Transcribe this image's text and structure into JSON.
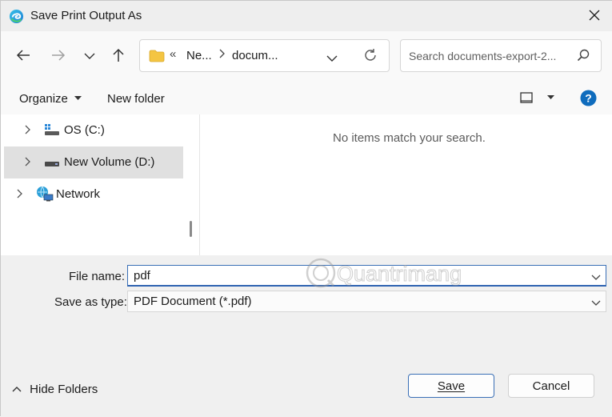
{
  "window": {
    "title": "Save Print Output As"
  },
  "address": {
    "overflow": "«",
    "crumbs": [
      "Ne...",
      "docum..."
    ]
  },
  "search": {
    "placeholder": "Search documents-export-2..."
  },
  "toolbar": {
    "organize": "Organize",
    "new_folder": "New folder"
  },
  "nav_tree": [
    {
      "label": "OS (C:)",
      "icon": "drive-icon",
      "selected": false
    },
    {
      "label": "New Volume (D:)",
      "icon": "drive-icon",
      "selected": true
    },
    {
      "label": "Network",
      "icon": "network-icon",
      "selected": false
    }
  ],
  "content": {
    "empty_message": "No items match your search."
  },
  "form": {
    "file_name_label": "File name:",
    "file_name_value": "pdf",
    "type_label": "Save as type:",
    "type_value": "PDF Document (*.pdf)"
  },
  "watermark": {
    "text": "Quantrimang"
  },
  "footer": {
    "hide_folders": "Hide Folders",
    "save": "Save",
    "cancel": "Cancel"
  },
  "colors": {
    "accent": "#2f63b1",
    "help": "#0f6cbd",
    "folder": "#f4c542"
  }
}
